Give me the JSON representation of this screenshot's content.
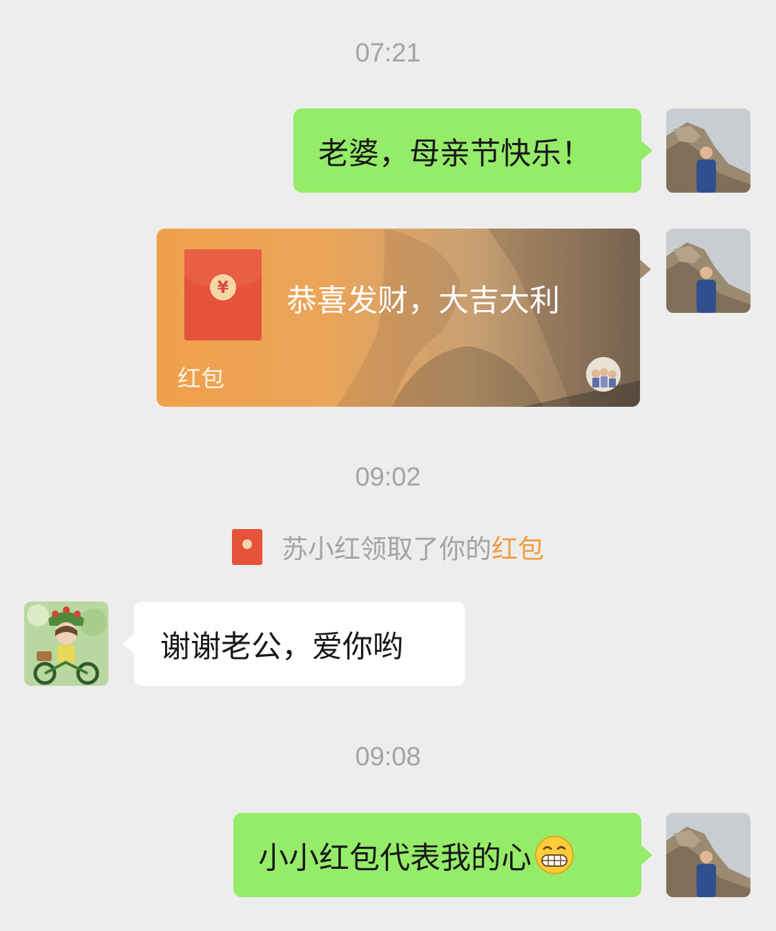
{
  "timestamps": [
    "07:21",
    "09:02",
    "09:08"
  ],
  "messages": {
    "m1": {
      "text": "老婆，母亲节快乐！",
      "sender": "me"
    },
    "m3": {
      "text": "谢谢老公，爱你哟",
      "sender": "other"
    },
    "m4": {
      "text": "小小红包代表我的心",
      "sender": "me",
      "emoji": "grinning-face-emoji"
    }
  },
  "red_packet": {
    "greeting": "恭喜发财，大吉大利",
    "label": "红包",
    "coin_symbol": "¥"
  },
  "notice": {
    "prefix": "苏小红领取了你的",
    "accent": "红包"
  },
  "colors": {
    "background": "#ededed",
    "my_bubble": "#95ec69",
    "other_bubble": "#ffffff",
    "red_packet": "#f0a04b",
    "accent": "#f09c42",
    "timestamp": "#a3a3a3"
  }
}
